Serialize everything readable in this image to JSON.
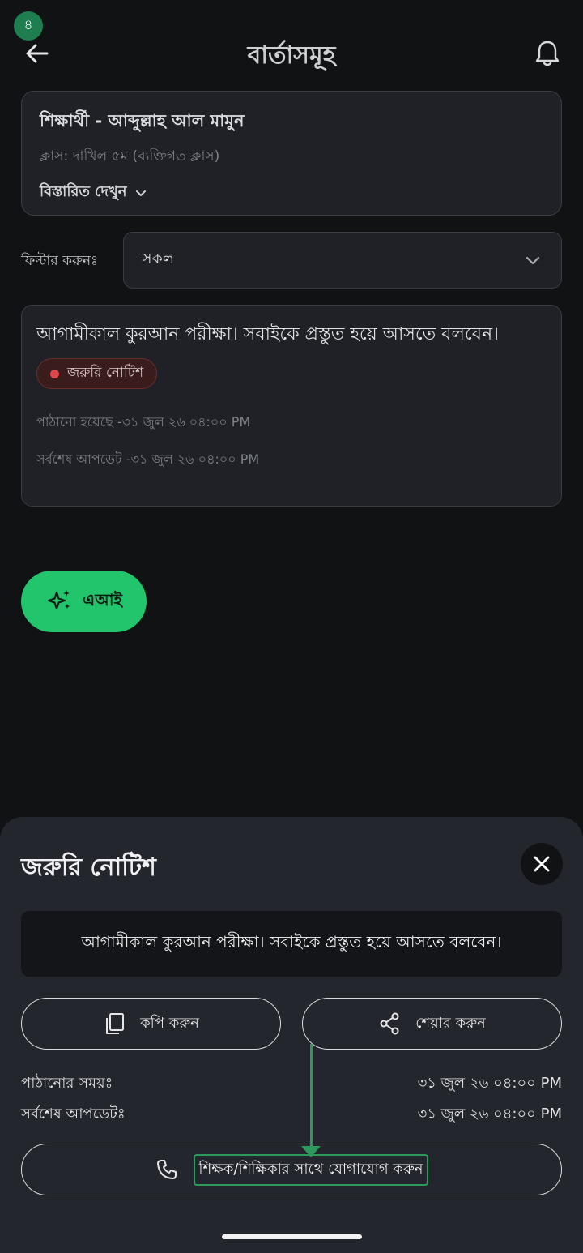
{
  "status_bar": {
    "badge": "৪"
  },
  "header": {
    "title": "বার্তাসমূহ",
    "back_icon": "arrow-left-icon",
    "bell_icon": "bell-icon"
  },
  "student_card": {
    "name": "শিক্ষার্থী - আব্দুল্লাহ আল মামুন",
    "class_info": "ক্লাস: দাখিল ৫ম  (ব্যক্তিগত ক্লাস)",
    "details_label": "বিস্তারিত দেখুন"
  },
  "filter": {
    "label": "ফিল্টার করুনঃ",
    "selected": "সকল"
  },
  "message_card": {
    "text": "আগামীকাল কুরআন পরীক্ষা। সবাইকে প্রস্তুত হয়ে আসতে বলবেন।",
    "tag": "জরুরি নোটিশ",
    "sent": "পাঠানো হয়েছে -৩১ জুল ২৬ ০৪:০০ PM",
    "updated": "সর্বশেষ আপডেট -৩১ জুল ২৬ ০৪:০০ PM"
  },
  "ai_button": {
    "label": "এআই"
  },
  "sheet": {
    "title": "জরুরি নোটিশ",
    "message": "আগামীকাল কুরআন পরীক্ষা। সবাইকে প্রস্তুত হয়ে আসতে বলবেন।",
    "copy_label": "কপি করুন",
    "share_label": "শেয়ার করুন",
    "sent_label": "পাঠানোর সময়ঃ",
    "sent_value": "৩১ জুল ২৬ ০৪:০০ PM",
    "updated_label": "সর্বশেষ আপডেটঃ",
    "updated_value": "৩১ জুল ২৬ ০৪:০০ PM",
    "contact_label": "শিক্ষক/শিক্ষিকার সাথে যোগাযোগ করুন"
  },
  "colors": {
    "accent": "#22c56b",
    "badge": "#1e7e4f",
    "urgent": "#e0474c",
    "annotation": "#2d9a5c"
  }
}
